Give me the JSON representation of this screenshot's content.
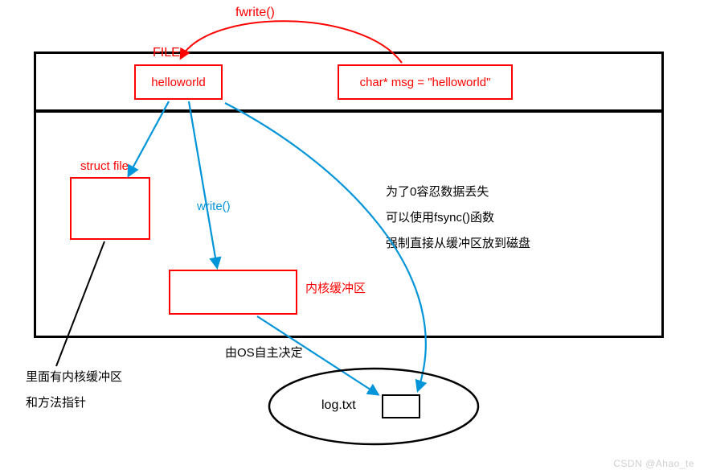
{
  "top_label": "fwrite()",
  "file_label": "FILE",
  "file_box_text": "helloworld",
  "msg_box_text": "char* msg = \"helloworld\"",
  "struct_file_label": "struct file",
  "write_label": "write()",
  "kernel_buf_label": "内核缓冲区",
  "fsync_note_line1": "为了0容忍数据丢失",
  "fsync_note_line2": "可以使用fsync()函数",
  "fsync_note_line3": "强制直接从缓冲区放到磁盘",
  "os_decide_label": "由OS自主决定",
  "disk_file_label": "log.txt",
  "struct_note_line1": "里面有内核缓冲区",
  "struct_note_line2": "和方法指针",
  "watermark": "CSDN @Ahao_te"
}
